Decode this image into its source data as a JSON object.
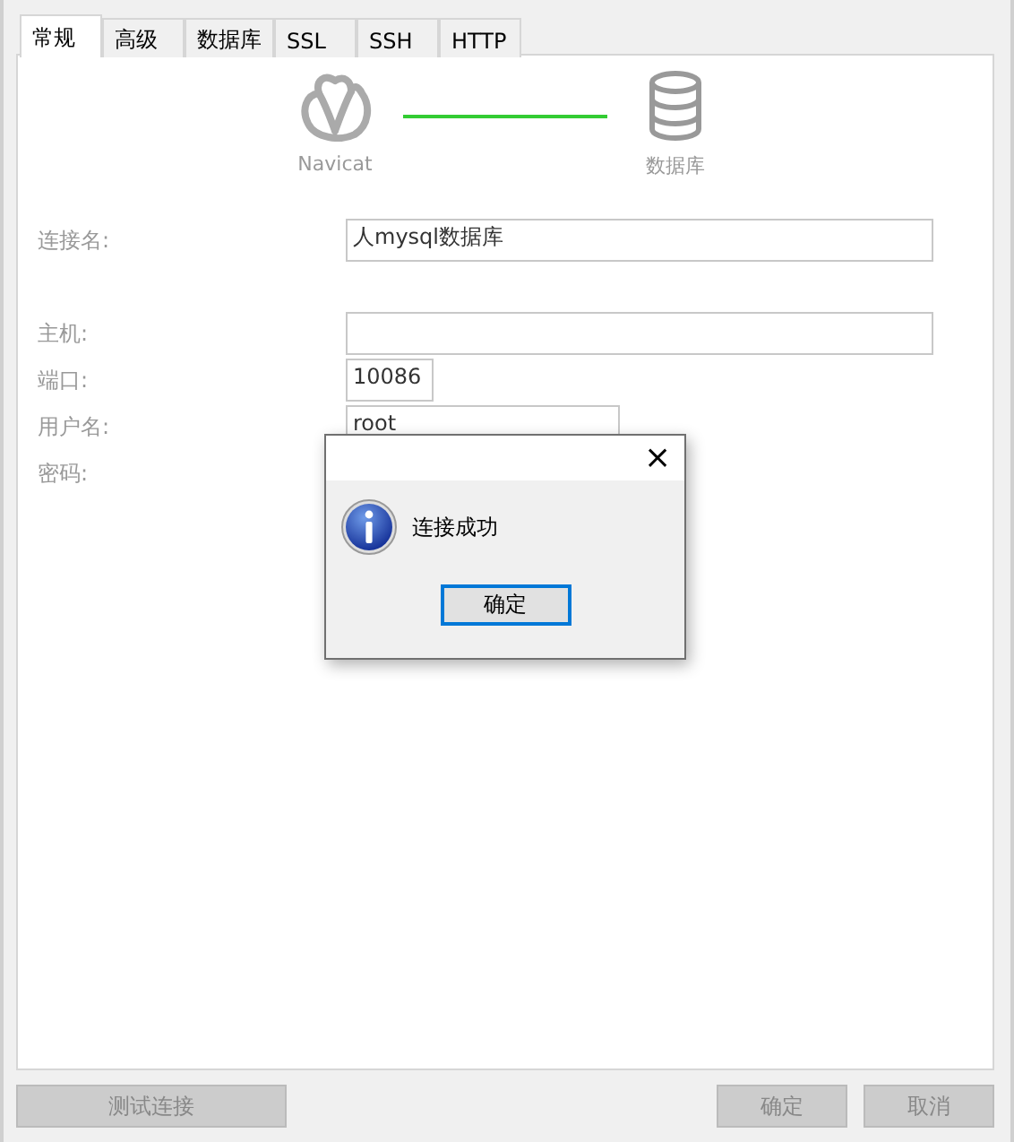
{
  "tabs": [
    {
      "label": "常规",
      "selected": true
    },
    {
      "label": "高级",
      "selected": false
    },
    {
      "label": "数据库",
      "selected": false
    },
    {
      "label": "SSL",
      "selected": false
    },
    {
      "label": "SSH",
      "selected": false
    },
    {
      "label": "HTTP",
      "selected": false
    }
  ],
  "diagram": {
    "left_label": "Navicat",
    "right_label": "数据库",
    "connected": true
  },
  "fields": [
    {
      "label": "连接名:",
      "value": "人mysql数据库"
    },
    {
      "label": "主机:"
    },
    {
      "label": "端口:",
      "value": "10086"
    },
    {
      "label": "用户名:",
      "value": "root"
    },
    {
      "label": "密码:"
    }
  ],
  "dialog": {
    "close": "×",
    "message": "连接成功",
    "button": "确定"
  },
  "buttons": [
    {
      "label": "测试连接",
      "disabled": true
    },
    {
      "label": "确定",
      "disabled": true
    },
    {
      "label": "取消",
      "disabled": true
    }
  ]
}
